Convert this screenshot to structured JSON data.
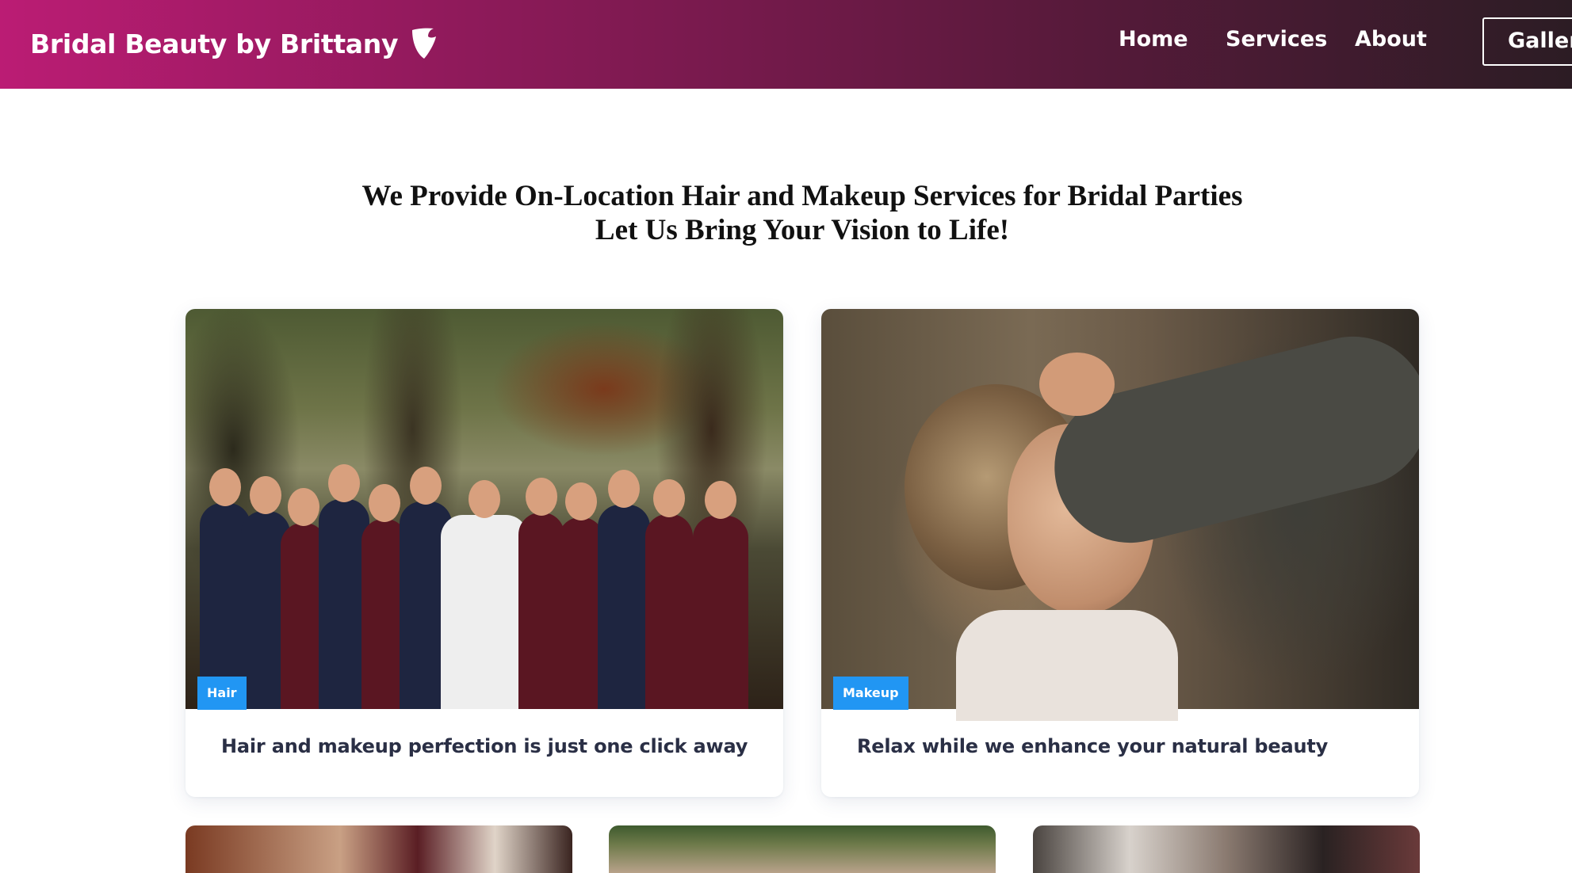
{
  "navbar": {
    "brand": "Bridal Beauty by Brittany",
    "logo_icon": "typo3-logo-icon",
    "links": {
      "home": "Home",
      "services": "Services",
      "about": "About",
      "gallery": "Gallery"
    },
    "gradient_colors": [
      "#bb1c74",
      "#5c1a3d",
      "#2c1c24"
    ]
  },
  "hero": {
    "line1": "We Provide On-Location Hair and Makeup Services for Bridal Parties",
    "line2": "Let Us Bring Your Vision to Life!"
  },
  "cards": [
    {
      "tag": "Hair",
      "caption": "Hair and makeup perfection is just one click away"
    },
    {
      "tag": "Makeup",
      "caption": "Relax while we enhance your natural beauty"
    }
  ],
  "colors": {
    "tag_background": "#2196f3",
    "caption_text": "#2a2f45"
  }
}
